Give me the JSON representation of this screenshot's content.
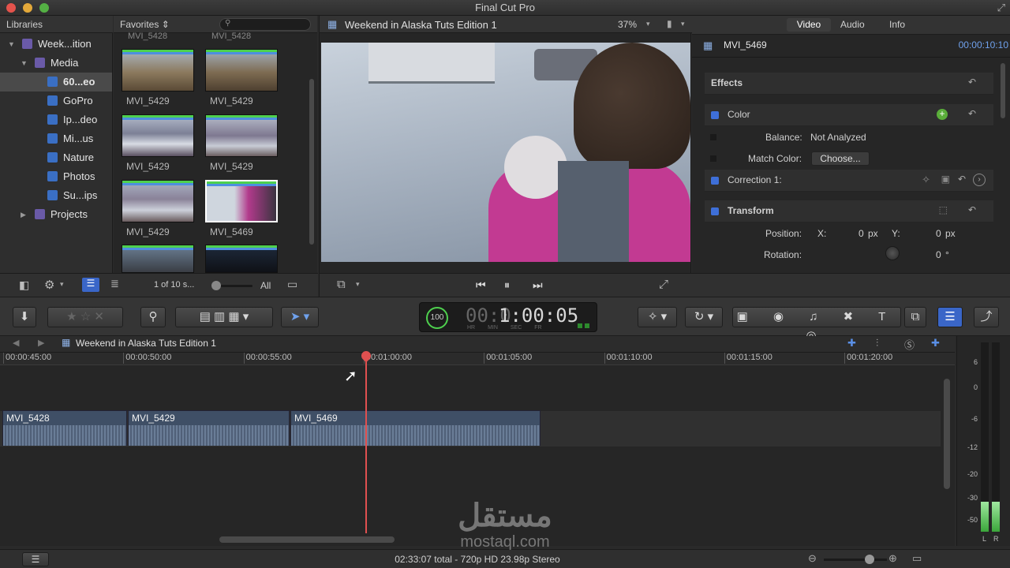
{
  "window": {
    "title": "Final Cut Pro"
  },
  "libraries": {
    "header": "Libraries",
    "items": [
      {
        "label": "Week...ition",
        "indent": 0,
        "type": "library",
        "disclosure": "open"
      },
      {
        "label": "Media",
        "indent": 1,
        "type": "event",
        "disclosure": "open"
      },
      {
        "label": "60...eo",
        "indent": 2,
        "type": "collection",
        "selected": true
      },
      {
        "label": "GoPro",
        "indent": 2,
        "type": "collection"
      },
      {
        "label": "Ip...deo",
        "indent": 2,
        "type": "collection"
      },
      {
        "label": "Mi...us",
        "indent": 2,
        "type": "collection"
      },
      {
        "label": "Nature",
        "indent": 2,
        "type": "collection"
      },
      {
        "label": "Photos",
        "indent": 2,
        "type": "collection"
      },
      {
        "label": "Su...ips",
        "indent": 2,
        "type": "collection"
      },
      {
        "label": "Projects",
        "indent": 1,
        "type": "event",
        "disclosure": "closed"
      }
    ]
  },
  "browser": {
    "filter": "Favorites",
    "top_labels": [
      "MVI_5428",
      "MVI_5428"
    ],
    "thumbs": [
      {
        "label": "MVI_5429",
        "scene": "grass"
      },
      {
        "label": "MVI_5429",
        "scene": "grass2"
      },
      {
        "label": "MVI_5429",
        "scene": "mountain"
      },
      {
        "label": "MVI_5429",
        "scene": "mountain2"
      },
      {
        "label": "MVI_5429",
        "scene": "mountain3"
      },
      {
        "label": "MVI_5469",
        "scene": "woman",
        "selected": true
      }
    ],
    "count": "1 of 10 s...",
    "show": "All"
  },
  "viewer": {
    "title": "Weekend in Alaska Tuts Edition 1",
    "zoom": "37%"
  },
  "inspector": {
    "tabs": [
      "Video",
      "Audio",
      "Info"
    ],
    "clip_name": "MVI_5469",
    "timecode": "00:00:10:10",
    "effects_label": "Effects",
    "color_label": "Color",
    "balance_label": "Balance:",
    "balance_value": "Not Analyzed",
    "match_label": "Match Color:",
    "match_button": "Choose...",
    "correction_label": "Correction 1:",
    "transform_label": "Transform",
    "position_label": "Position:",
    "x_label": "X:",
    "x_value": "0",
    "y_label": "Y:",
    "y_value": "0",
    "px": "px",
    "rotation_label": "Rotation:",
    "rotation_value": "0",
    "deg": "°"
  },
  "dashboard": {
    "percent": "100",
    "timecode": "1:00:05",
    "units": [
      "HR",
      "MIN",
      "SEC",
      "FR"
    ]
  },
  "timeline": {
    "project": "Weekend in Alaska Tuts Edition 1",
    "ruler": [
      "00:00:45:00",
      "00:00:50:00",
      "00:00:55:00",
      "00:01:00:00",
      "00:01:05:00",
      "00:01:10:00",
      "00:01:15:00",
      "00:01:20:00"
    ],
    "clips": [
      "MVI_5428",
      "MVI_5429",
      "MVI_5469"
    ],
    "meter_scale": [
      "6",
      "0",
      "-6",
      "-12",
      "-20",
      "-30",
      "-50"
    ],
    "meter_channels": [
      "L",
      "R"
    ]
  },
  "status": {
    "summary": "02:33:07 total - 720p HD 23.98p Stereo"
  },
  "watermark": {
    "arabic": "مستقل",
    "latin": "mostaql.com"
  },
  "colors": {
    "accent": "#3e6fd8",
    "playhead": "#e05050",
    "green": "#4ed04e"
  }
}
